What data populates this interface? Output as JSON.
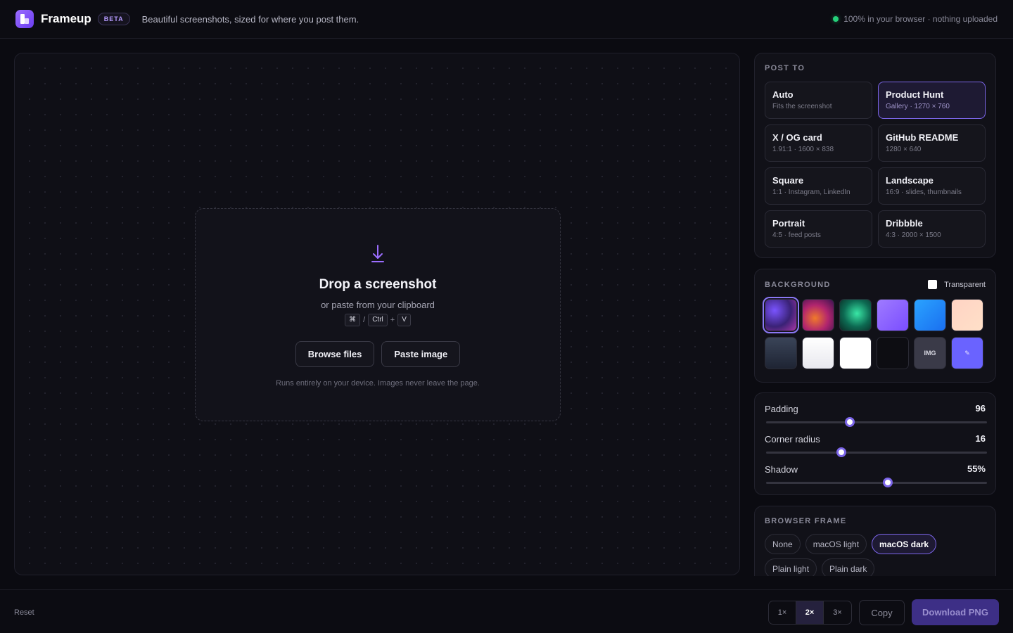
{
  "header": {
    "app_name": "Frameup",
    "badge": "BETA",
    "tagline": "Beautiful screenshots, sized for where you post them.",
    "status": "100% in your browser · nothing uploaded"
  },
  "dropzone": {
    "title": "Drop a screenshot",
    "subtitle": "or paste from your clipboard",
    "keys": [
      "⌘",
      "/",
      "Ctrl",
      "+",
      "V"
    ],
    "browse_label": "Browse files",
    "paste_label": "Paste image",
    "note": "Runs entirely on your device. Images never leave the page."
  },
  "post_to": {
    "title": "POST TO",
    "options": [
      {
        "label": "Auto",
        "sub": "Fits the screenshot",
        "active": false
      },
      {
        "label": "Product Hunt",
        "sub": "Gallery · 1270 × 760",
        "active": true
      },
      {
        "label": "X / OG card",
        "sub": "1.91:1 · 1600 × 838",
        "active": false
      },
      {
        "label": "GitHub README",
        "sub": "1280 × 640",
        "active": false
      },
      {
        "label": "Square",
        "sub": "1:1 · Instagram, LinkedIn",
        "active": false
      },
      {
        "label": "Landscape",
        "sub": "16:9 · slides, thumbnails",
        "active": false
      },
      {
        "label": "Portrait",
        "sub": "4:5 · feed posts",
        "active": false
      },
      {
        "label": "Dribbble",
        "sub": "4:3 · 2000 × 1500",
        "active": false
      }
    ]
  },
  "background": {
    "title": "BACKGROUND",
    "transparent_label": "Transparent",
    "swatches": [
      {
        "name": "purple-glow-swatch",
        "label": "",
        "selected": true
      },
      {
        "name": "sunset-swatch",
        "label": "",
        "selected": false
      },
      {
        "name": "emerald-swatch",
        "label": "",
        "selected": false
      },
      {
        "name": "violet-swatch",
        "label": "",
        "selected": false
      },
      {
        "name": "blue-swatch",
        "label": "",
        "selected": false
      },
      {
        "name": "peach-swatch",
        "label": "",
        "selected": false
      },
      {
        "name": "slate-swatch",
        "label": "",
        "selected": false
      },
      {
        "name": "light-gray-swatch",
        "label": "",
        "selected": false
      },
      {
        "name": "white-swatch",
        "label": "",
        "selected": false
      },
      {
        "name": "black-swatch",
        "label": "",
        "selected": false
      },
      {
        "name": "image-swatch",
        "label": "IMG",
        "selected": false
      },
      {
        "name": "custom-color-swatch",
        "label": "✎",
        "selected": false
      }
    ]
  },
  "adjustments": {
    "padding": {
      "label": "Padding",
      "value": "96",
      "level": 0.38
    },
    "radius": {
      "label": "Corner radius",
      "value": "16",
      "level": 0.34
    },
    "shadow": {
      "label": "Shadow",
      "value": "55%",
      "level": 0.55
    }
  },
  "browser_frame": {
    "title": "BROWSER FRAME",
    "options": [
      {
        "label": "None",
        "active": false
      },
      {
        "label": "macOS light",
        "active": false
      },
      {
        "label": "macOS dark",
        "active": true
      },
      {
        "label": "Plain light",
        "active": false
      },
      {
        "label": "Plain dark",
        "active": false
      }
    ]
  },
  "footer": {
    "reset_label": "Reset",
    "scales": [
      {
        "label": "1×",
        "active": false
      },
      {
        "label": "2×",
        "active": true
      },
      {
        "label": "3×",
        "active": false
      }
    ],
    "copy_label": "Copy",
    "download_label": "Download PNG"
  },
  "colors": {
    "accent": "#7b65e8",
    "status_dot": "#25d07a",
    "background": "#0b0b11"
  }
}
